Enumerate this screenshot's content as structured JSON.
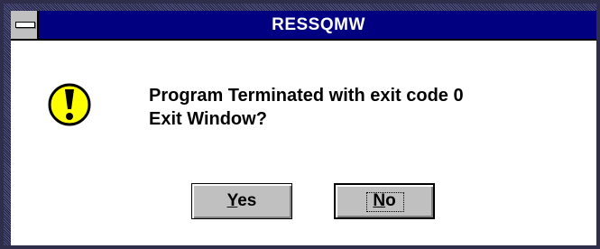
{
  "window": {
    "title": "RESSQMW"
  },
  "dialog": {
    "icon": "exclamation-icon",
    "message_line1": "Program Terminated with exit code 0",
    "message_line2": "Exit Window?"
  },
  "buttons": {
    "yes_mnemonic": "Y",
    "yes_rest": "es",
    "no_mnemonic": "N",
    "no_rest": "o"
  },
  "colors": {
    "titlebar": "#000080",
    "face": "#c0c0c0",
    "icon_fill": "#ffff00"
  }
}
